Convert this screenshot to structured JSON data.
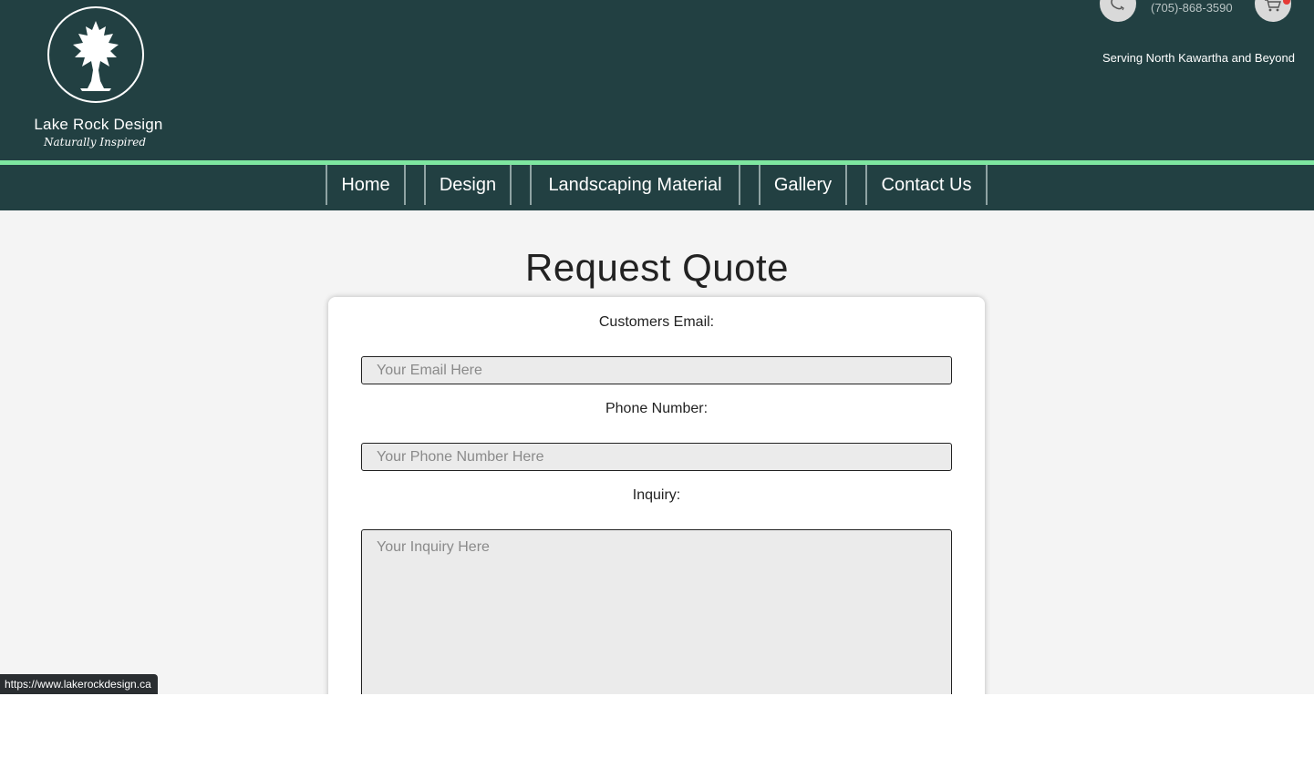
{
  "header": {
    "brand_name": "Lake Rock Design",
    "tagline": "Naturally Inspired",
    "phone": "(705)-868-3590",
    "service_area": "Serving North Kawartha and Beyond",
    "logo_icon": "tree-icon",
    "phone_icon": "phone-icon",
    "cart_icon": "cart-icon"
  },
  "nav": {
    "items": [
      {
        "label": "Home"
      },
      {
        "label": "Design"
      },
      {
        "label": "Landscaping Material"
      },
      {
        "label": "Gallery"
      },
      {
        "label": "Contact Us"
      }
    ]
  },
  "main": {
    "title": "Request Quote",
    "form": {
      "email_label": "Customers Email:",
      "email_placeholder": "Your Email Here",
      "phone_label": "Phone Number:",
      "phone_placeholder": "Your Phone Number Here",
      "inquiry_label": "Inquiry:",
      "inquiry_placeholder": "Your Inquiry Here"
    }
  },
  "status_bar": {
    "url": "https://www.lakerockdesign.ca"
  },
  "colors": {
    "header_bg": "#224042",
    "accent": "#7ee6a0",
    "page_bg": "#f4f4f4",
    "field_bg": "#ebebeb"
  }
}
